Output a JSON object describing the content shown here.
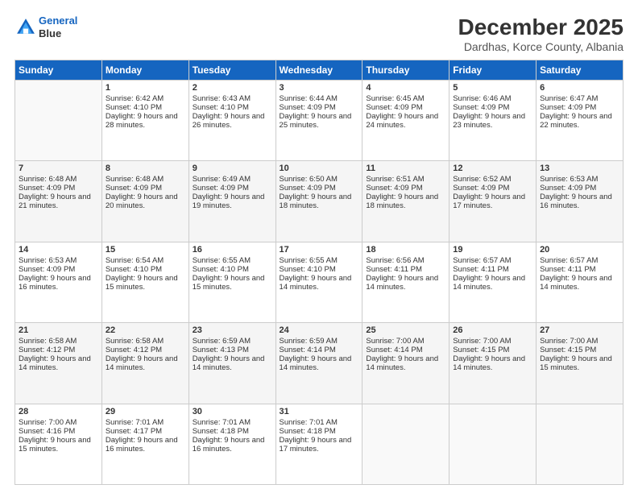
{
  "header": {
    "logo_line1": "General",
    "logo_line2": "Blue",
    "title": "December 2025",
    "subtitle": "Dardhas, Korce County, Albania"
  },
  "days_of_week": [
    "Sunday",
    "Monday",
    "Tuesday",
    "Wednesday",
    "Thursday",
    "Friday",
    "Saturday"
  ],
  "weeks": [
    [
      {
        "day": "",
        "sunrise": "",
        "sunset": "",
        "daylight": ""
      },
      {
        "day": "1",
        "sunrise": "Sunrise: 6:42 AM",
        "sunset": "Sunset: 4:10 PM",
        "daylight": "Daylight: 9 hours and 28 minutes."
      },
      {
        "day": "2",
        "sunrise": "Sunrise: 6:43 AM",
        "sunset": "Sunset: 4:10 PM",
        "daylight": "Daylight: 9 hours and 26 minutes."
      },
      {
        "day": "3",
        "sunrise": "Sunrise: 6:44 AM",
        "sunset": "Sunset: 4:09 PM",
        "daylight": "Daylight: 9 hours and 25 minutes."
      },
      {
        "day": "4",
        "sunrise": "Sunrise: 6:45 AM",
        "sunset": "Sunset: 4:09 PM",
        "daylight": "Daylight: 9 hours and 24 minutes."
      },
      {
        "day": "5",
        "sunrise": "Sunrise: 6:46 AM",
        "sunset": "Sunset: 4:09 PM",
        "daylight": "Daylight: 9 hours and 23 minutes."
      },
      {
        "day": "6",
        "sunrise": "Sunrise: 6:47 AM",
        "sunset": "Sunset: 4:09 PM",
        "daylight": "Daylight: 9 hours and 22 minutes."
      }
    ],
    [
      {
        "day": "7",
        "sunrise": "Sunrise: 6:48 AM",
        "sunset": "Sunset: 4:09 PM",
        "daylight": "Daylight: 9 hours and 21 minutes."
      },
      {
        "day": "8",
        "sunrise": "Sunrise: 6:48 AM",
        "sunset": "Sunset: 4:09 PM",
        "daylight": "Daylight: 9 hours and 20 minutes."
      },
      {
        "day": "9",
        "sunrise": "Sunrise: 6:49 AM",
        "sunset": "Sunset: 4:09 PM",
        "daylight": "Daylight: 9 hours and 19 minutes."
      },
      {
        "day": "10",
        "sunrise": "Sunrise: 6:50 AM",
        "sunset": "Sunset: 4:09 PM",
        "daylight": "Daylight: 9 hours and 18 minutes."
      },
      {
        "day": "11",
        "sunrise": "Sunrise: 6:51 AM",
        "sunset": "Sunset: 4:09 PM",
        "daylight": "Daylight: 9 hours and 18 minutes."
      },
      {
        "day": "12",
        "sunrise": "Sunrise: 6:52 AM",
        "sunset": "Sunset: 4:09 PM",
        "daylight": "Daylight: 9 hours and 17 minutes."
      },
      {
        "day": "13",
        "sunrise": "Sunrise: 6:53 AM",
        "sunset": "Sunset: 4:09 PM",
        "daylight": "Daylight: 9 hours and 16 minutes."
      }
    ],
    [
      {
        "day": "14",
        "sunrise": "Sunrise: 6:53 AM",
        "sunset": "Sunset: 4:09 PM",
        "daylight": "Daylight: 9 hours and 16 minutes."
      },
      {
        "day": "15",
        "sunrise": "Sunrise: 6:54 AM",
        "sunset": "Sunset: 4:10 PM",
        "daylight": "Daylight: 9 hours and 15 minutes."
      },
      {
        "day": "16",
        "sunrise": "Sunrise: 6:55 AM",
        "sunset": "Sunset: 4:10 PM",
        "daylight": "Daylight: 9 hours and 15 minutes."
      },
      {
        "day": "17",
        "sunrise": "Sunrise: 6:55 AM",
        "sunset": "Sunset: 4:10 PM",
        "daylight": "Daylight: 9 hours and 14 minutes."
      },
      {
        "day": "18",
        "sunrise": "Sunrise: 6:56 AM",
        "sunset": "Sunset: 4:11 PM",
        "daylight": "Daylight: 9 hours and 14 minutes."
      },
      {
        "day": "19",
        "sunrise": "Sunrise: 6:57 AM",
        "sunset": "Sunset: 4:11 PM",
        "daylight": "Daylight: 9 hours and 14 minutes."
      },
      {
        "day": "20",
        "sunrise": "Sunrise: 6:57 AM",
        "sunset": "Sunset: 4:11 PM",
        "daylight": "Daylight: 9 hours and 14 minutes."
      }
    ],
    [
      {
        "day": "21",
        "sunrise": "Sunrise: 6:58 AM",
        "sunset": "Sunset: 4:12 PM",
        "daylight": "Daylight: 9 hours and 14 minutes."
      },
      {
        "day": "22",
        "sunrise": "Sunrise: 6:58 AM",
        "sunset": "Sunset: 4:12 PM",
        "daylight": "Daylight: 9 hours and 14 minutes."
      },
      {
        "day": "23",
        "sunrise": "Sunrise: 6:59 AM",
        "sunset": "Sunset: 4:13 PM",
        "daylight": "Daylight: 9 hours and 14 minutes."
      },
      {
        "day": "24",
        "sunrise": "Sunrise: 6:59 AM",
        "sunset": "Sunset: 4:14 PM",
        "daylight": "Daylight: 9 hours and 14 minutes."
      },
      {
        "day": "25",
        "sunrise": "Sunrise: 7:00 AM",
        "sunset": "Sunset: 4:14 PM",
        "daylight": "Daylight: 9 hours and 14 minutes."
      },
      {
        "day": "26",
        "sunrise": "Sunrise: 7:00 AM",
        "sunset": "Sunset: 4:15 PM",
        "daylight": "Daylight: 9 hours and 14 minutes."
      },
      {
        "day": "27",
        "sunrise": "Sunrise: 7:00 AM",
        "sunset": "Sunset: 4:15 PM",
        "daylight": "Daylight: 9 hours and 15 minutes."
      }
    ],
    [
      {
        "day": "28",
        "sunrise": "Sunrise: 7:00 AM",
        "sunset": "Sunset: 4:16 PM",
        "daylight": "Daylight: 9 hours and 15 minutes."
      },
      {
        "day": "29",
        "sunrise": "Sunrise: 7:01 AM",
        "sunset": "Sunset: 4:17 PM",
        "daylight": "Daylight: 9 hours and 16 minutes."
      },
      {
        "day": "30",
        "sunrise": "Sunrise: 7:01 AM",
        "sunset": "Sunset: 4:18 PM",
        "daylight": "Daylight: 9 hours and 16 minutes."
      },
      {
        "day": "31",
        "sunrise": "Sunrise: 7:01 AM",
        "sunset": "Sunset: 4:18 PM",
        "daylight": "Daylight: 9 hours and 17 minutes."
      },
      {
        "day": "",
        "sunrise": "",
        "sunset": "",
        "daylight": ""
      },
      {
        "day": "",
        "sunrise": "",
        "sunset": "",
        "daylight": ""
      },
      {
        "day": "",
        "sunrise": "",
        "sunset": "",
        "daylight": ""
      }
    ]
  ]
}
